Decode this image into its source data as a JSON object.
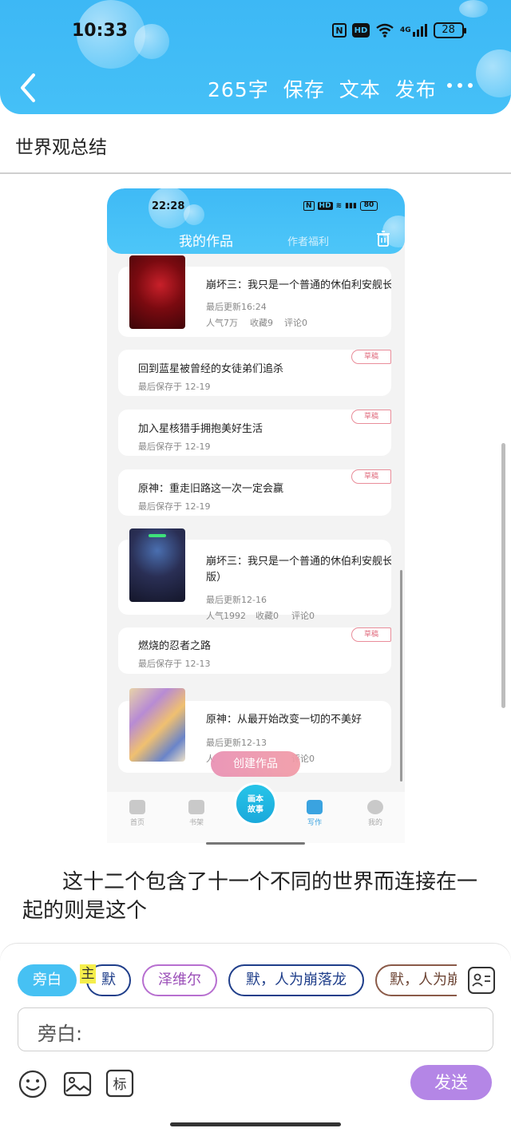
{
  "status_bar": {
    "time": "10:33",
    "nfc": "N",
    "hd": "HD",
    "network": "4G",
    "battery": "28"
  },
  "header": {
    "word_count": "265字",
    "save_label": "保存",
    "text_label": "文本",
    "publish_label": "发布"
  },
  "document": {
    "title": "世界观总结",
    "body": "这十二个包含了十一个不同的世界而连接在一起的则是这个"
  },
  "screenshot": {
    "status_time": "22:28",
    "battery": "80",
    "tabs": {
      "active": "我的作品",
      "other": "作者福利"
    },
    "works": [
      {
        "title": "崩坏三：我只是一个普通的休伯利安舰长",
        "meta": "最后更新16:24",
        "stats": [
          "人气7万",
          "收藏9",
          "评论0"
        ],
        "draft": ""
      },
      {
        "title": "回到蓝星被曾经的女徒弟们追杀",
        "meta": "最后保存于 12-19",
        "draft": "草稿"
      },
      {
        "title": "加入星核猎手拥抱美好生活",
        "meta": "最后保存于 12-19",
        "draft": "草稿"
      },
      {
        "title": "原神：重走旧路这一次一定会赢",
        "meta": "最后保存于 12-19",
        "draft": "草稿"
      },
      {
        "title": "崩坏三：我只是一个普通的休伯利安舰长",
        "title2": "版）",
        "meta": "最后更新12-16",
        "stats": [
          "人气1992",
          "收藏0",
          "评论0"
        ],
        "draft": ""
      },
      {
        "title": "燃烧的忍者之路",
        "meta": "最后保存于 12-13",
        "draft": "草稿"
      },
      {
        "title": "原神：从最开始改变一切的不美好",
        "meta": "最后更新12-13",
        "stats": [
          "人",
          "评论0"
        ],
        "draft": ""
      }
    ],
    "create_button": "创建作品",
    "tabbar": {
      "home": "首页",
      "shelf": "书架",
      "center_line1": "画本",
      "center_line2": "故事",
      "write": "写作",
      "mine": "我的"
    }
  },
  "composer": {
    "chips": [
      "旁白",
      "默",
      "泽维尔",
      "默，人为崩落龙",
      "默，人为崩"
    ],
    "highlight_char": "主",
    "input_prefix": "旁白:",
    "send_label": "发送"
  },
  "icons": [
    "back-icon",
    "more-icon",
    "trash-icon",
    "contact-card-icon",
    "emoji-icon",
    "image-icon",
    "tag-icon"
  ],
  "colors": {
    "header": "#3db8f5",
    "send": "#b486e6",
    "narrator_chip": "#46c1f3",
    "draft_tag": "#e06b7d"
  }
}
